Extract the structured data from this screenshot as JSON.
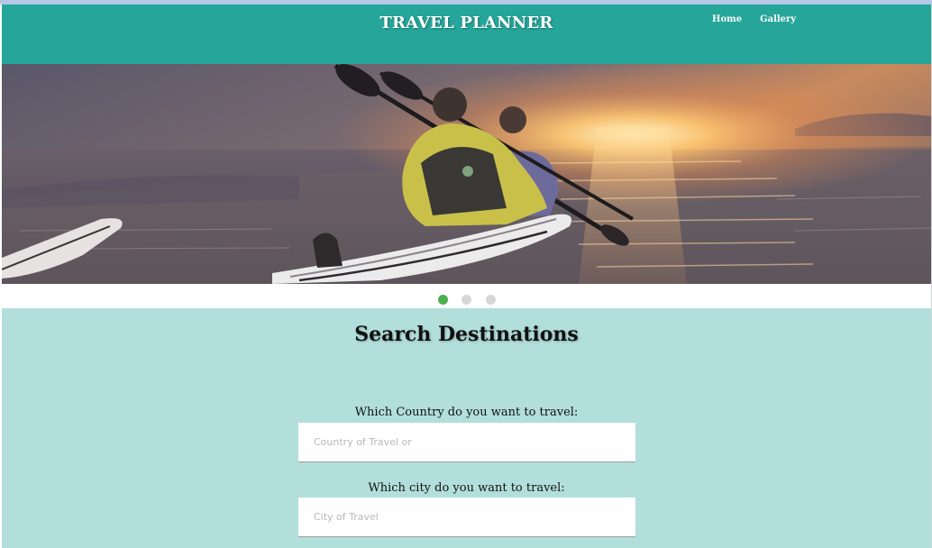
{
  "header": {
    "brand": "TRAVEL PLANNER",
    "nav": [
      {
        "label": "Home"
      },
      {
        "label": "Gallery"
      }
    ]
  },
  "carousel": {
    "slide_count": 3,
    "active_index": 0,
    "image": "sea-kayaking-at-sunset"
  },
  "search": {
    "title": "Search Destinations",
    "country_label": "Which Country do you want to travel:",
    "country_placeholder": "Country of Travel or",
    "country_value": "",
    "city_label": "Which city do you want to travel:",
    "city_placeholder": "City of Travel",
    "city_value": ""
  },
  "colors": {
    "navbar": "#26a69a",
    "search_background": "#b2dfdb",
    "active_dot": "#4caf50",
    "inactive_dot": "#d6d6d6"
  }
}
